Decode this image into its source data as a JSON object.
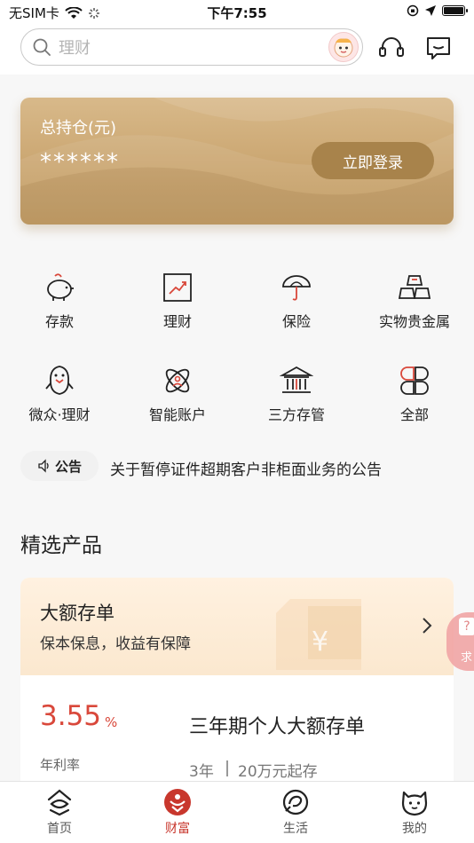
{
  "status_bar": {
    "carrier": "无SIM卡",
    "time": "下午7:55"
  },
  "header": {
    "search_placeholder": "理财",
    "icons": [
      "search-icon",
      "avatar-icon",
      "headset-icon",
      "message-icon"
    ]
  },
  "asset_card": {
    "label": "总持仓(元)",
    "masked_value": "******",
    "login_button": "立即登录"
  },
  "menu_grid": [
    {
      "label": "存款",
      "icon": "piggy-bank-icon"
    },
    {
      "label": "理财",
      "icon": "trend-chart-icon"
    },
    {
      "label": "保险",
      "icon": "umbrella-icon"
    },
    {
      "label": "实物贵金属",
      "icon": "gold-bars-icon"
    },
    {
      "label": "微众·理财",
      "icon": "penguin-icon"
    },
    {
      "label": "智能账户",
      "icon": "atom-icon"
    },
    {
      "label": "三方存管",
      "icon": "bank-building-icon"
    },
    {
      "label": "全部",
      "icon": "grid-all-icon"
    }
  ],
  "notice": {
    "tag": "公告",
    "text": "关于暂停证件超期客户非柜面业务的公告"
  },
  "featured": {
    "section_title": "精选产品",
    "category_title": "大额存单",
    "category_subtitle": "保本保息，收益有保障",
    "rate_value": "3.55",
    "rate_unit": "%",
    "rate_label": "年利率",
    "product_name": "三年期个人大额存单",
    "term": "3年",
    "min_amount": "20万元起存"
  },
  "float_tag": {
    "text": "求"
  },
  "tab_bar": {
    "tabs": [
      {
        "label": "首页",
        "icon": "home-icon"
      },
      {
        "label": "财富",
        "icon": "wealth-icon",
        "active": true
      },
      {
        "label": "生活",
        "icon": "life-icon"
      },
      {
        "label": "我的",
        "icon": "profile-icon"
      }
    ]
  },
  "colors": {
    "accent": "#c8372d",
    "gold": "#c9a46e",
    "gold_button": "#a8834b"
  }
}
